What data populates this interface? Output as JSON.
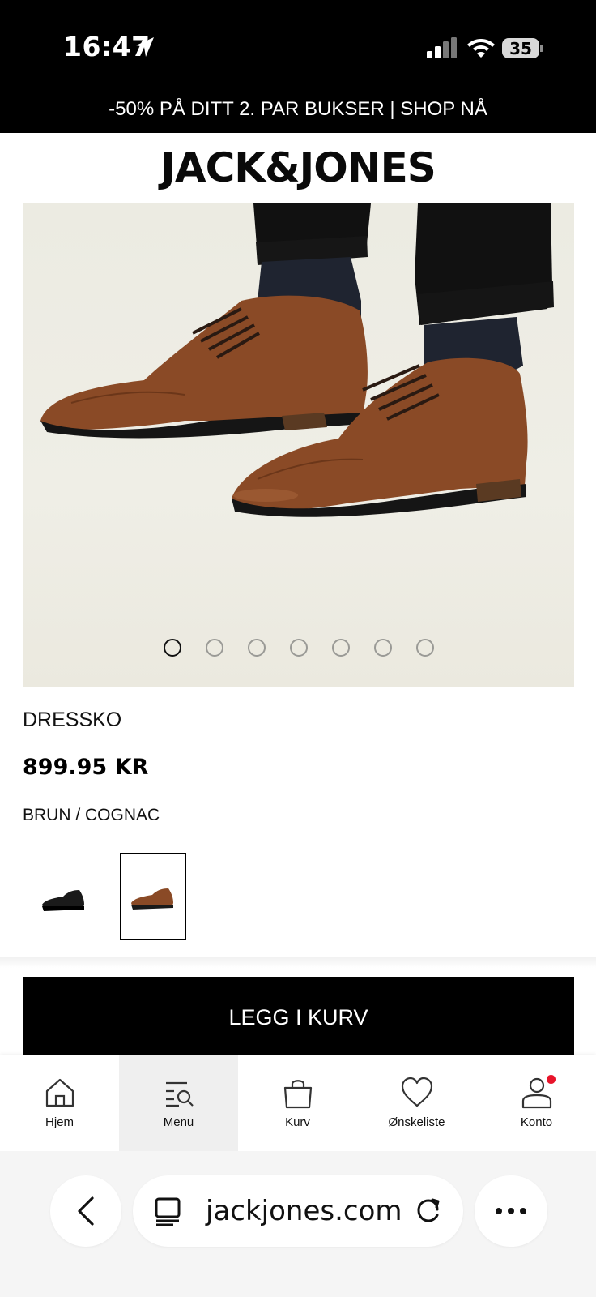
{
  "status_bar": {
    "time": "16:47",
    "battery": "35",
    "icons": [
      "location-arrow-icon",
      "cellular-signal-icon",
      "wifi-icon",
      "battery-icon"
    ]
  },
  "promo_banner": "-50% PÅ DITT 2. PAR BUKSER | SHOP NÅ",
  "brand": {
    "logo_text": "JACK&JONES"
  },
  "product": {
    "name": "DRESSKO",
    "price": "899.95 KR",
    "color": "BRUN / COGNAC",
    "image_count": 7,
    "active_image": 1,
    "swatches": [
      {
        "name": "black",
        "selected": false,
        "color": "#1a1a1a"
      },
      {
        "name": "brown",
        "selected": true,
        "color": "#8a4a26"
      }
    ]
  },
  "add_to_cart_label": "LEGG I KURV",
  "bottom_nav": {
    "items": [
      {
        "label": "Hjem",
        "icon": "home-icon",
        "active": false
      },
      {
        "label": "Menu",
        "icon": "menu-search-icon",
        "active": true
      },
      {
        "label": "Kurv",
        "icon": "shopping-bag-icon",
        "active": false
      },
      {
        "label": "Ønskeliste",
        "icon": "heart-icon",
        "active": false
      },
      {
        "label": "Konto",
        "icon": "account-icon",
        "active": false,
        "notification": true
      }
    ]
  },
  "browser": {
    "url": "jackjones.com",
    "icons": [
      "back-icon",
      "tabs-icon",
      "reload-icon",
      "more-icon"
    ]
  },
  "colors": {
    "accent": "#000000",
    "notification": "#e8142a",
    "leather": "#8a4a26"
  }
}
